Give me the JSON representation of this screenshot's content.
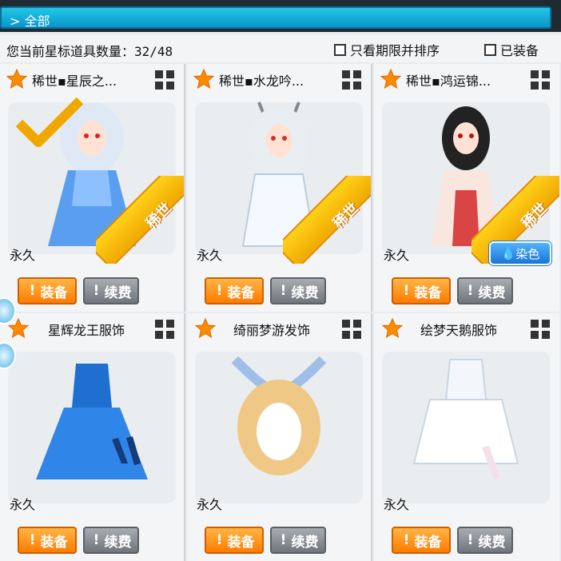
{
  "header": {
    "tab_label": "全部",
    "chevron": "chevron-right-icon"
  },
  "status": {
    "count_label": "您当前星标道具数量：",
    "count_value": "32/48"
  },
  "filters": {
    "limited_label": "只看期限并排序",
    "equipped_label": "已装备"
  },
  "colors": {
    "accent": "#ff8a00",
    "tab": "#0b95c9",
    "ribbon": "#f7b500",
    "dye": "#1a74d4"
  },
  "items": [
    {
      "name": "稀世▪星辰之...",
      "duration": "永久",
      "equip_label": "装备",
      "renew_label": "续费",
      "badge": "稀世",
      "equipped": true
    },
    {
      "name": "稀世▪水龙吟...",
      "duration": "永久",
      "equip_label": "装备",
      "renew_label": "续费",
      "badge": "稀世"
    },
    {
      "name": "稀世▪鸿运锦...",
      "duration": "永久",
      "equip_label": "装备",
      "renew_label": "续费",
      "badge": "稀世",
      "dye_label": "染色"
    },
    {
      "name": "星辉龙王服饰",
      "duration": "永久",
      "equip_label": "装备",
      "renew_label": "续费"
    },
    {
      "name": "绮丽梦游发饰",
      "duration": "永久",
      "equip_label": "装备",
      "renew_label": "续费"
    },
    {
      "name": "绘梦天鹅服饰",
      "duration": "永久",
      "equip_label": "装备",
      "renew_label": "续费"
    }
  ]
}
